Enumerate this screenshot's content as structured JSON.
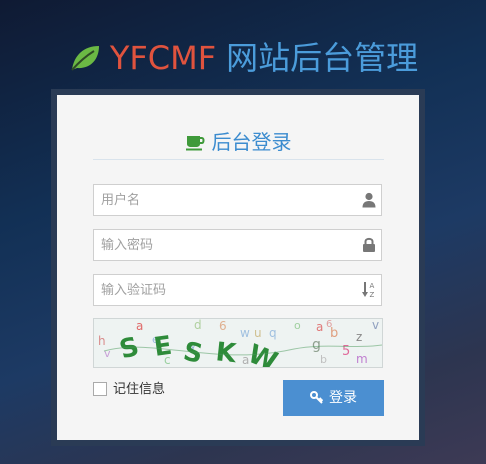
{
  "header": {
    "brand_name": "YFCMF",
    "brand_subtitle": "网站后台管理",
    "leaf_icon": "leaf-icon"
  },
  "login": {
    "title": "后台登录",
    "title_icon": "coffee-cup-icon",
    "username": {
      "value": "",
      "placeholder": "用户名",
      "icon": "user-icon"
    },
    "password": {
      "value": "",
      "placeholder": "输入密码",
      "icon": "lock-icon"
    },
    "verify_code": {
      "value": "",
      "placeholder": "输入验证码",
      "icon": "sort-alpha-icon"
    },
    "captcha_text": "SESKW",
    "remember_label": "记住信息",
    "remember_checked": false,
    "submit_label": "登录",
    "submit_icon": "key-icon"
  },
  "colors": {
    "brand_name": "#e0533e",
    "brand_subtitle": "#4b9cdb",
    "leaf": "#6bb944",
    "title": "#3c8ccf",
    "button": "#4b8fd1",
    "captcha_text": "#2e8b3a"
  }
}
